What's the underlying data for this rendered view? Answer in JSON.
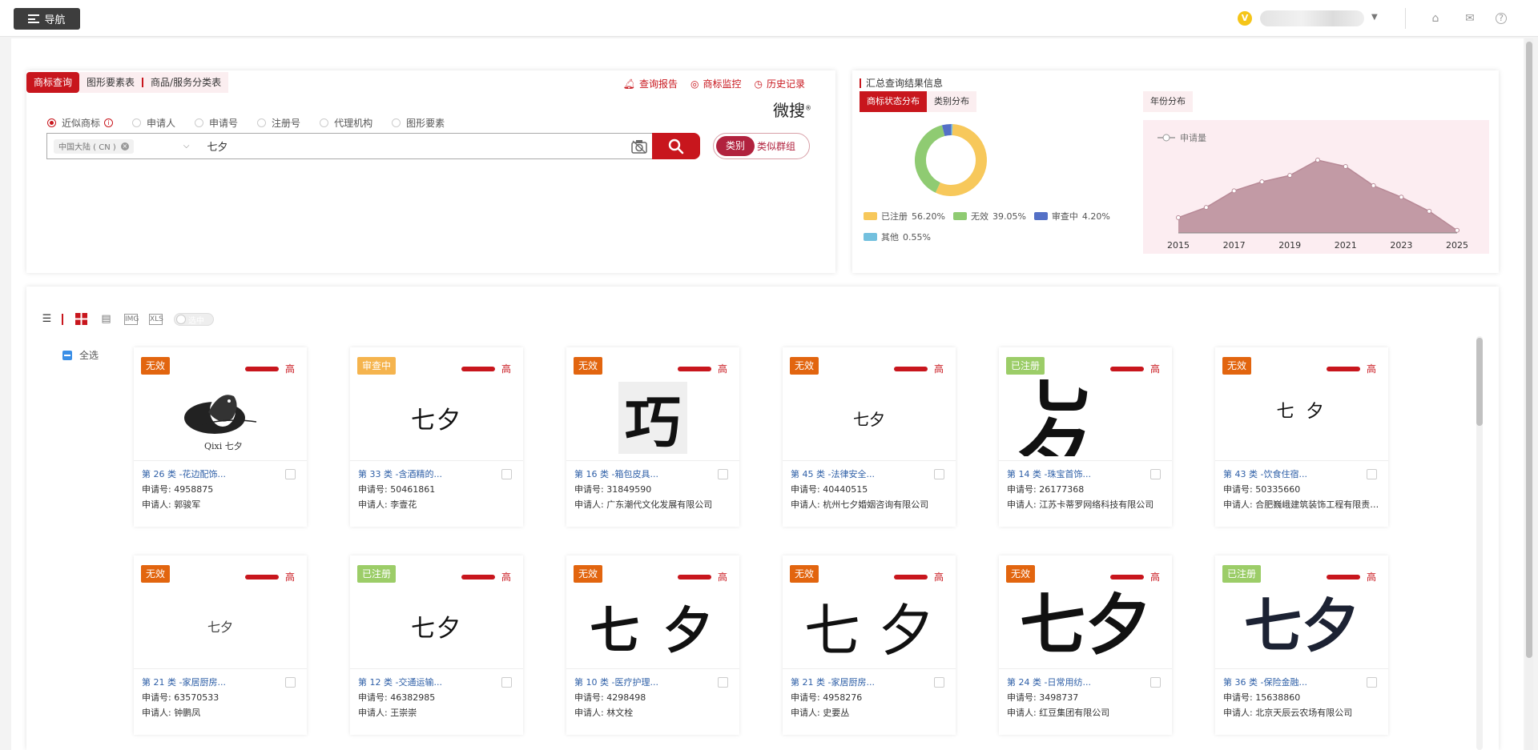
{
  "header": {
    "nav_label": "导航",
    "user_badge": "V"
  },
  "search": {
    "tabs": [
      "商标查询",
      "图形要素表",
      "商品/服务分类表"
    ],
    "tools": [
      "查询报告",
      "商标监控",
      "历史记录"
    ],
    "brand_name": "微搜",
    "brand_mark": "®",
    "radio_options": [
      "近似商标",
      "申请人",
      "申请号",
      "注册号",
      "代理机构",
      "图形要素"
    ],
    "selected_radio": "近似商标",
    "region": "中国大陆 ( CN )",
    "query": "七夕",
    "mode_toggle": {
      "active": "类别",
      "inactive": "类似群组"
    }
  },
  "summary": {
    "title": "汇总查询结果信息",
    "tabs": [
      "商标状态分布",
      "类别分布"
    ],
    "year_tab": "年份分布",
    "status_distribution": [
      {
        "label": "已注册",
        "value": "56.20%",
        "pct": 56.2,
        "color": "#f7c85b"
      },
      {
        "label": "无效",
        "value": "39.05%",
        "pct": 39.05,
        "color": "#8fcb72"
      },
      {
        "label": "审查中",
        "value": "4.20%",
        "pct": 4.2,
        "color": "#5470c6"
      },
      {
        "label": "其他",
        "value": "0.55%",
        "pct": 0.55,
        "color": "#73c0de"
      }
    ],
    "year_chart": {
      "type": "area",
      "legend": "申请量",
      "x_ticks": [
        "2015",
        "2017",
        "2019",
        "2021",
        "2023",
        "2025"
      ],
      "values": [
        12,
        20,
        33,
        40,
        45,
        57,
        52,
        37,
        28,
        17,
        2
      ]
    }
  },
  "results": {
    "select_all_label": "全选",
    "switch_label": "选中",
    "level_label": "高",
    "cards": [
      {
        "status": "无效",
        "status_color": "#e2650f",
        "cls": "第 26 类 -花边配饰...",
        "reg_no": "申请号: 4958875",
        "applicant": "申请人: 郭骏军",
        "logo_text": "Qixi 七夕",
        "logo_style": "bird"
      },
      {
        "status": "审查中",
        "status_color": "#f5b44e",
        "cls": "第 33 类 -含酒精的...",
        "reg_no": "申请号: 50461861",
        "applicant": "申请人: 李壹花",
        "logo_text": "七夕",
        "logo_style": "plain"
      },
      {
        "status": "无效",
        "status_color": "#e2650f",
        "cls": "第 16 类 -箱包皮具...",
        "reg_no": "申请号: 31849590",
        "applicant": "申请人: 广东潮代文化发展有限公司",
        "logo_text": "巧",
        "logo_style": "big"
      },
      {
        "status": "无效",
        "status_color": "#e2650f",
        "cls": "第 45 类 -法律安全...",
        "reg_no": "申请号: 40440515",
        "applicant": "申请人: 杭州七夕婚姻咨询有限公司",
        "logo_text": "七夕",
        "logo_style": "small"
      },
      {
        "status": "已注册",
        "status_color": "#9ccd68",
        "cls": "第 14 类 -珠宝首饰...",
        "reg_no": "申请号: 26177368",
        "applicant": "申请人: 江苏卡蒂罗网络科技有限公司",
        "logo_text": "七夕",
        "logo_style": "heavy"
      },
      {
        "status": "无效",
        "status_color": "#e2650f",
        "cls": "第 43 类 -饮食住宿...",
        "reg_no": "申请号: 50335660",
        "applicant": "申请人: 合肥巍峨建筑装饰工程有限责任公司",
        "logo_text": "七 夕",
        "logo_style": "spaced"
      },
      {
        "status": "无效",
        "status_color": "#e2650f",
        "cls": "第 21 类 -家居厨房...",
        "reg_no": "申请号: 63570533",
        "applicant": "申请人: 钟鹏凤",
        "logo_text": "七夕",
        "logo_style": "tiny"
      },
      {
        "status": "已注册",
        "status_color": "#9ccd68",
        "cls": "第 12 类 -交通运输...",
        "reg_no": "申请号: 46382985",
        "applicant": "申请人: 王崇崇",
        "logo_text": "七夕",
        "logo_style": "plain"
      },
      {
        "status": "无效",
        "status_color": "#e2650f",
        "cls": "第 10 类 -医疗护理...",
        "reg_no": "申请号: 4298498",
        "applicant": "申请人: 林文栓",
        "logo_text": "七 夕",
        "logo_style": "brush"
      },
      {
        "status": "无效",
        "status_color": "#e2650f",
        "cls": "第 21 类 -家居厨房...",
        "reg_no": "申请号: 4958276",
        "applicant": "申请人: 史要丛",
        "logo_text": "七 夕",
        "logo_style": "thin"
      },
      {
        "status": "无效",
        "status_color": "#e2650f",
        "cls": "第 24 类 -日常用纺...",
        "reg_no": "申请号: 3498737",
        "applicant": "申请人: 红豆集团有限公司",
        "logo_text": "七夕",
        "logo_style": "bold"
      },
      {
        "status": "已注册",
        "status_color": "#9ccd68",
        "cls": "第 36 类 -保险金融...",
        "reg_no": "申请号: 15638860",
        "applicant": "申请人: 北京天辰云农场有限公司",
        "logo_text": "七夕",
        "logo_style": "block"
      }
    ]
  }
}
